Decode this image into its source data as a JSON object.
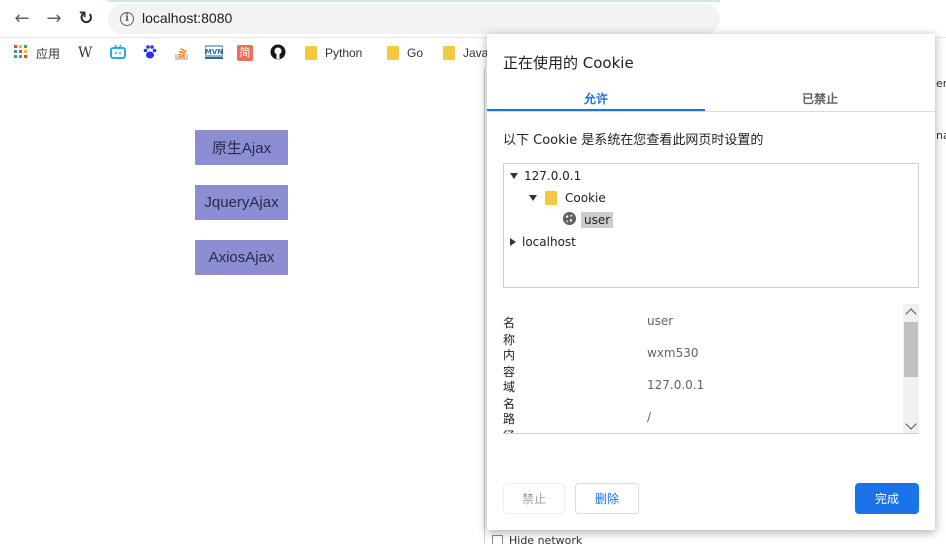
{
  "browser": {
    "url": "localhost:8080",
    "back_icon": "←",
    "forward_icon": "→",
    "reload_icon": "↻",
    "info_icon": "i"
  },
  "bookmarks": {
    "apps": "应用",
    "wiki": "W",
    "jian": "简",
    "items": [
      "Python",
      "Go",
      "Java"
    ]
  },
  "page": {
    "buttons": [
      "原生Ajax",
      "JqueryAjax",
      "AxiosAjax"
    ]
  },
  "devtools": {
    "frag1": "er",
    "frag2": "na",
    "hide_network": "Hide network"
  },
  "dialog": {
    "title": "正在使用的 Cookie",
    "tabs": [
      "允许",
      "已禁止"
    ],
    "description": "以下 Cookie 是系统在您查看此网页时设置的",
    "tree": {
      "host": "127.0.0.1",
      "folder": "Cookie",
      "cookie": "user",
      "other_host": "localhost"
    },
    "details": [
      {
        "key": "名称",
        "value": "user"
      },
      {
        "key": "内容",
        "value": "wxm530"
      },
      {
        "key": "域名",
        "value": "127.0.0.1"
      },
      {
        "key": "路径",
        "value": "/"
      }
    ],
    "buttons": {
      "block": "禁止",
      "remove": "删除",
      "done": "完成"
    }
  },
  "colors": {
    "accent": "#1a73e8",
    "page_button": "#8d8dd3"
  }
}
